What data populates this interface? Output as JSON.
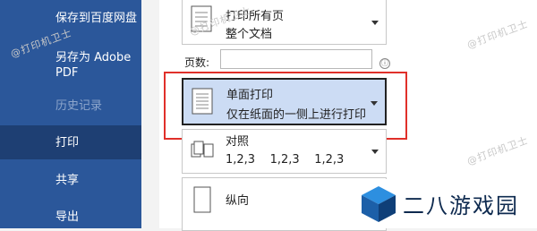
{
  "sidebar": {
    "items": [
      {
        "label": "保存到百度网盘",
        "state": "normal"
      },
      {
        "label": "另存为 Adobe PDF",
        "state": "normal"
      },
      {
        "label": "历史记录",
        "state": "disabled"
      },
      {
        "label": "打印",
        "state": "active"
      },
      {
        "label": "共享",
        "state": "normal"
      },
      {
        "label": "导出",
        "state": "normal"
      }
    ]
  },
  "print_settings": {
    "print_pages": {
      "title": "打印所有页",
      "subtitle": "整个文档"
    },
    "pages_label": "页数:",
    "pages_value": "",
    "info_icon": "ⓘ",
    "sides": {
      "title": "单面打印",
      "subtitle": "仅在纸面的一侧上进行打印"
    },
    "collate": {
      "title": "对照",
      "subtitle": "1,2,3    1,2,3    1,2,3"
    },
    "orientation": {
      "title": "纵向"
    }
  },
  "watermark": {
    "text": "@打印机卫士"
  },
  "logo": {
    "text": "二八游戏园"
  }
}
